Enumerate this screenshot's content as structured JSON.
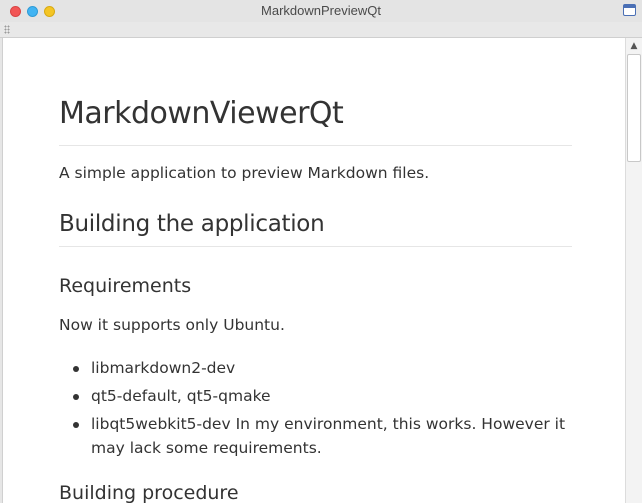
{
  "window": {
    "title": "MarkdownPreviewQt"
  },
  "document": {
    "heading1": "MarkdownViewerQt",
    "intro": "A simple application to preview Markdown files.",
    "heading2": "Building the application",
    "requirements_heading": "Requirements",
    "requirements_text": "Now it supports only Ubuntu.",
    "requirements_list": [
      "libmarkdown2-dev",
      "qt5-default, qt5-qmake",
      "libqt5webkit5-dev In my environment, this works. However it may lack some requirements."
    ],
    "procedure_heading": "Building procedure"
  },
  "scrollbar": {
    "up_arrow": "▲"
  },
  "colors": {
    "close": "#f25656",
    "minimize": "#41b4f3",
    "maximize": "#f4c525",
    "text": "#333333"
  }
}
